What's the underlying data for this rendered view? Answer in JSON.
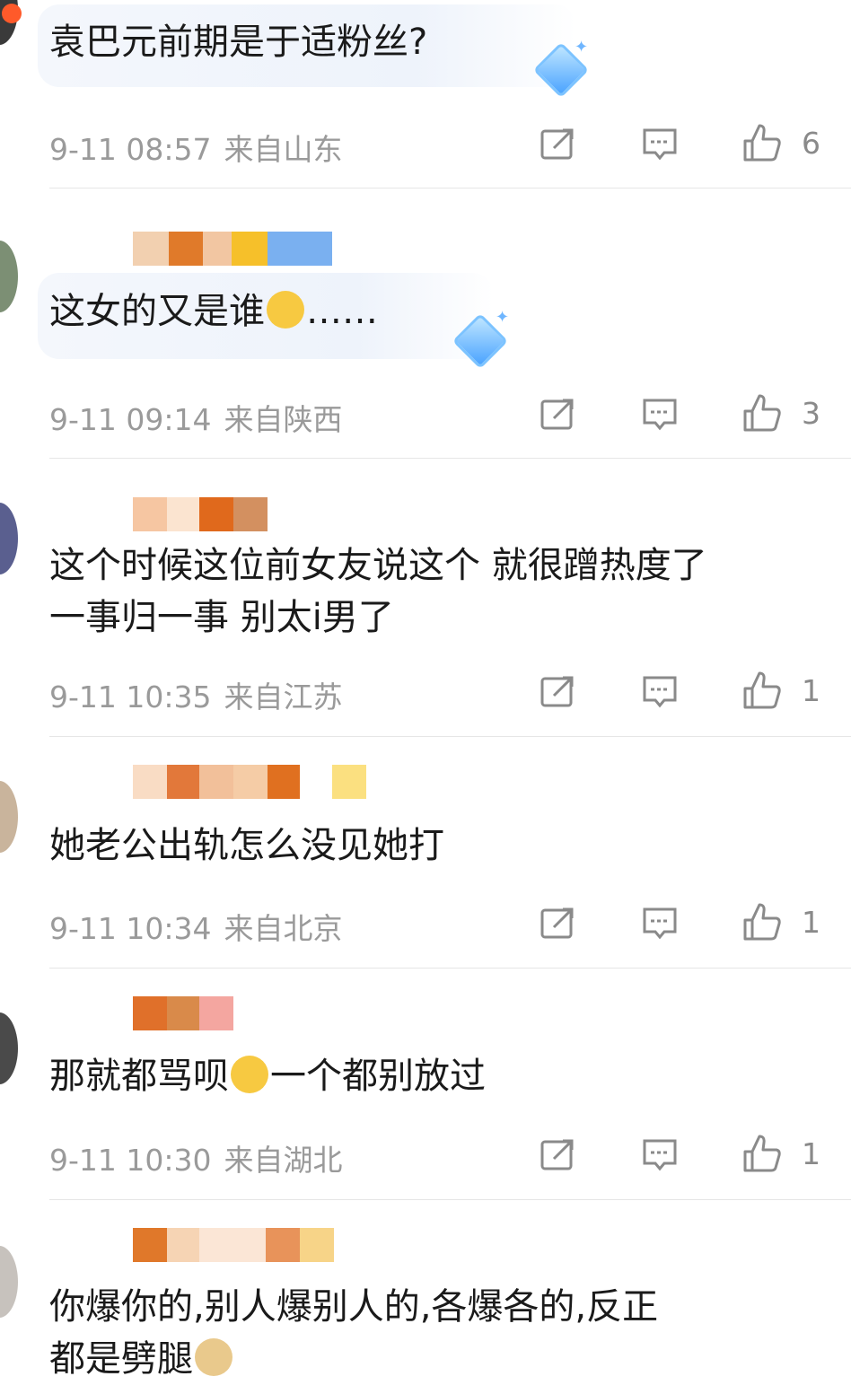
{
  "comments": [
    {
      "text": "袁巴元前期是于适粉丝?",
      "time": "9-11 08:57",
      "location": "来自山东",
      "likes": "6",
      "colors": [
        "#f0c9a8",
        "#e07a2a",
        "#f2d0b0",
        "#f6c02a",
        "#7ab0f0"
      ]
    },
    {
      "text": "这女的又是谁",
      "text_tail": "……",
      "time": "9-11 09:14",
      "location": "来自陕西",
      "likes": "3",
      "colors": [
        "#f0c9a8",
        "#e07a2a",
        "#f2d0b0",
        "#f6c02a",
        "#7ab0f0"
      ]
    },
    {
      "text": "这个时候这位前女友说这个 就很蹭热度了",
      "text_line2": "一事归一事 别太i男了",
      "time": "9-11 10:35",
      "location": "来自江苏",
      "likes": "1",
      "colors": [
        "#f6c6a2",
        "#fbe4d0",
        "#e0691c",
        "#d39060"
      ]
    },
    {
      "text": "她老公出轨怎么没见她打",
      "time": "9-11 10:34",
      "location": "来自北京",
      "likes": "1",
      "colors": [
        "#f9dcc4",
        "#e2783a",
        "#f2c09a",
        "#f5cca6",
        "#e07020",
        "#fbe080"
      ]
    },
    {
      "text": "那就都骂呗",
      "text_tail": "一个都别放过",
      "time": "9-11 10:30",
      "location": "来自湖北",
      "likes": "1",
      "colors": [
        "#e0702a",
        "#d98a4a",
        "#f4a6a0"
      ]
    },
    {
      "text": "你爆你的,别人爆别人的,各爆各的,反正",
      "text_line2": "都是劈腿",
      "colors": [
        "#e0782a",
        "#f6d4b4",
        "#fbe6d6",
        "#e8935a",
        "#f7d488"
      ]
    }
  ],
  "icons": [
    "share-icon",
    "comment-icon",
    "like-icon",
    "gem-icon",
    "laugh-cry-emoji",
    "doge-emoji"
  ]
}
